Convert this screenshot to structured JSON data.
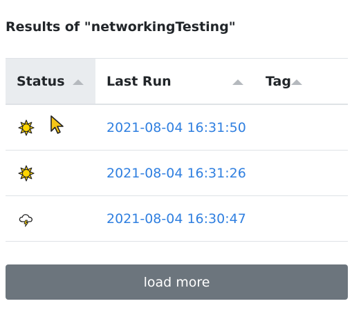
{
  "page": {
    "title": "Results of \"networkingTesting\""
  },
  "table": {
    "headers": {
      "status": "Status",
      "last_run": "Last Run",
      "tag": "Tag"
    },
    "rows": [
      {
        "status_icon": "sun-icon",
        "last_run": "2021-08-04 16:31:50",
        "tag": ""
      },
      {
        "status_icon": "sun-icon",
        "last_run": "2021-08-04 16:31:26",
        "tag": ""
      },
      {
        "status_icon": "storm-cloud-icon",
        "last_run": "2021-08-04 16:30:47",
        "tag": ""
      }
    ]
  },
  "buttons": {
    "load_more": "load more"
  },
  "colors": {
    "link": "#2f7fe0",
    "button_bg": "#6c757d",
    "header_active_bg": "#e9ecef",
    "sun_fill": "#ffd500"
  }
}
